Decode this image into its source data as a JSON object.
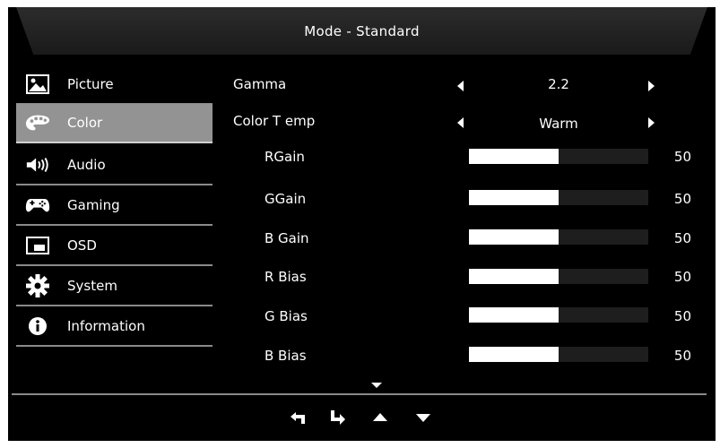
{
  "header": {
    "title": "Mode - Standard"
  },
  "sidebar": {
    "items": [
      {
        "label": "Picture",
        "icon": "picture-icon"
      },
      {
        "label": "Color",
        "icon": "palette-icon",
        "active": true
      },
      {
        "label": "Audio",
        "icon": "speaker-icon"
      },
      {
        "label": "Gaming",
        "icon": "gamepad-icon"
      },
      {
        "label": "OSD",
        "icon": "osd-icon"
      },
      {
        "label": "System",
        "icon": "gear-icon"
      },
      {
        "label": "Information",
        "icon": "info-icon"
      }
    ]
  },
  "main": {
    "gamma": {
      "label": "Gamma",
      "value": "2.2"
    },
    "color_temp": {
      "label": "Color T emp",
      "value": "Warm"
    },
    "sliders": [
      {
        "label": "RGain",
        "value": "50",
        "level_percent": 50
      },
      {
        "label": "GGain",
        "value": "50",
        "level_percent": 50
      },
      {
        "label": "B Gain",
        "value": "50",
        "level_percent": 50
      },
      {
        "label": "R Bias",
        "value": "50",
        "level_percent": 50
      },
      {
        "label": "G Bias",
        "value": "50",
        "level_percent": 50
      },
      {
        "label": "B Bias",
        "value": "50",
        "level_percent": 50
      }
    ]
  },
  "footer": {
    "buttons": [
      "back-icon",
      "enter-icon",
      "up-icon",
      "down-icon"
    ]
  },
  "colors": {
    "background": "#000000",
    "active_item": "#939393",
    "divider": "#8a8a8a",
    "slider_fill": "#ffffff",
    "slider_track": "#1e1e1e"
  }
}
